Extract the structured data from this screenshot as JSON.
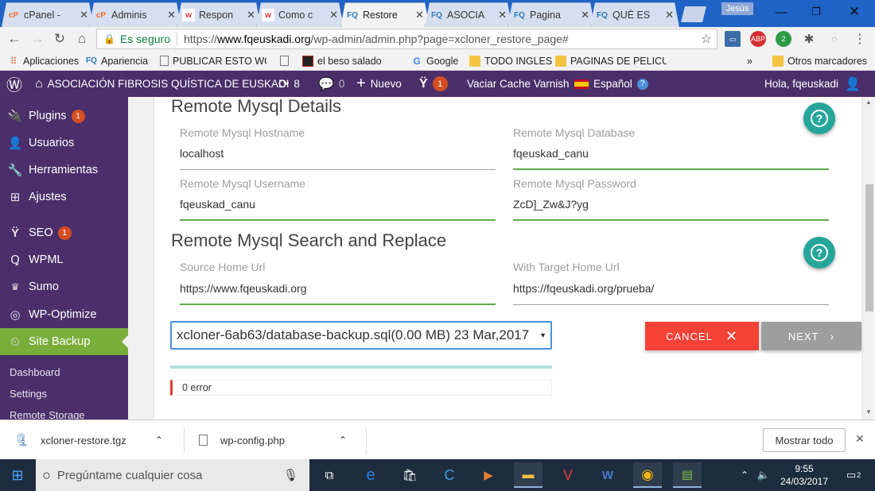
{
  "browser": {
    "tabs": [
      {
        "label": "cPanel -",
        "icon": "cpanel-icon",
        "color": "#ff6c2c",
        "active": false
      },
      {
        "label": "Adminis",
        "icon": "cpanel-icon",
        "color": "#ff6c2c",
        "active": false
      },
      {
        "label": "Respon",
        "icon": "w-icon",
        "color": "#d33",
        "active": false
      },
      {
        "label": "Como c",
        "icon": "w-icon",
        "color": "#d33",
        "active": false
      },
      {
        "label": "Restore",
        "icon": "fq-icon",
        "color": "#2a7ab8",
        "active": true
      },
      {
        "label": "ASOCIA",
        "icon": "fq-icon",
        "color": "#2a7ab8",
        "active": false
      },
      {
        "label": "Pagina",
        "icon": "fq-icon",
        "color": "#2a7ab8",
        "active": false
      },
      {
        "label": "QUÉ ES",
        "icon": "fq-icon",
        "color": "#2a7ab8",
        "active": false
      }
    ],
    "user": "Jesús",
    "secure_label": "Es seguro",
    "url_prefix": "https://",
    "url_host": "www.fqeuskadi.org",
    "url_path": "/wp-admin/admin.php?page=xcloner_restore_page#",
    "bookmarks": [
      {
        "label": "Aplicaciones",
        "icon": "apps-icon"
      },
      {
        "label": "Apariencia",
        "icon": "fq-icon"
      },
      {
        "label": "PUBLICAR ESTO WOR",
        "icon": "page-icon"
      },
      {
        "label": "",
        "icon": "page-icon"
      },
      {
        "label": "el beso salado",
        "icon": "image-icon"
      },
      {
        "label": "Google",
        "icon": "google-icon"
      },
      {
        "label": "TODO INGLES",
        "icon": "folder-icon"
      },
      {
        "label": "PAGINAS DE PELICUL",
        "icon": "folder-icon"
      }
    ],
    "more": "»",
    "other_bookmarks": "Otros marcadores"
  },
  "adminbar": {
    "site_name": "ASOCIACIÓN FIBROSIS QUÍSTICA DE EUSKADI",
    "updates": "8",
    "comments": "0",
    "new": "Nuevo",
    "seo_count": "1",
    "varnish": "Vaciar Cache Varnish",
    "language": "Español",
    "greeting": "Hola, fqeuskadi"
  },
  "sidebar": {
    "items": [
      {
        "label": "Plugins",
        "icon": "plugin-icon",
        "badge": "1"
      },
      {
        "label": "Usuarios",
        "icon": "user-icon",
        "badge": ""
      },
      {
        "label": "Herramientas",
        "icon": "wrench-icon",
        "badge": ""
      },
      {
        "label": "Ajustes",
        "icon": "settings-icon",
        "badge": ""
      },
      {
        "label": "SEO",
        "icon": "yoast-icon",
        "badge": "1"
      },
      {
        "label": "WPML",
        "icon": "wpml-icon",
        "badge": ""
      },
      {
        "label": "Sumo",
        "icon": "crown-icon",
        "badge": ""
      },
      {
        "label": "WP-Optimize",
        "icon": "optimize-icon",
        "badge": ""
      },
      {
        "label": "Site Backup",
        "icon": "backup-icon",
        "badge": "",
        "active": true
      }
    ],
    "submenu": [
      "Dashboard",
      "Settings",
      "Remote Storage"
    ]
  },
  "main": {
    "mysql_details": {
      "title": "Remote Mysql Details",
      "hostname_label": "Remote Mysql Hostname",
      "hostname": "localhost",
      "database_label": "Remote Mysql Database",
      "database": "fqeuskad_canu",
      "username_label": "Remote Mysql Username",
      "username": "fqeuskad_canu",
      "password_label": "Remote Mysql Password",
      "password": "ZcD]_Zw&J?yg"
    },
    "search_replace": {
      "title": "Remote Mysql Search and Replace",
      "source_label": "Source Home Url",
      "source": "https://www.fqeuskadi.org",
      "target_label": "With Target Home Url",
      "target": "https://fqeuskadi.org/prueba/"
    },
    "backup_select": "xcloner-6ab63/database-backup.sql(0.00 MB) 23 Mar,2017",
    "cancel_label": "CANCEL",
    "next_label": "NEXT",
    "error_text": "0 error"
  },
  "downloads": {
    "files": [
      "xcloner-restore.tgz",
      "wp-config.php"
    ],
    "show_all": "Mostrar todo"
  },
  "taskbar": {
    "search_placeholder": "Pregúntame cualquier cosa",
    "time": "9:55",
    "date": "24/03/2017",
    "notifications": "2"
  }
}
